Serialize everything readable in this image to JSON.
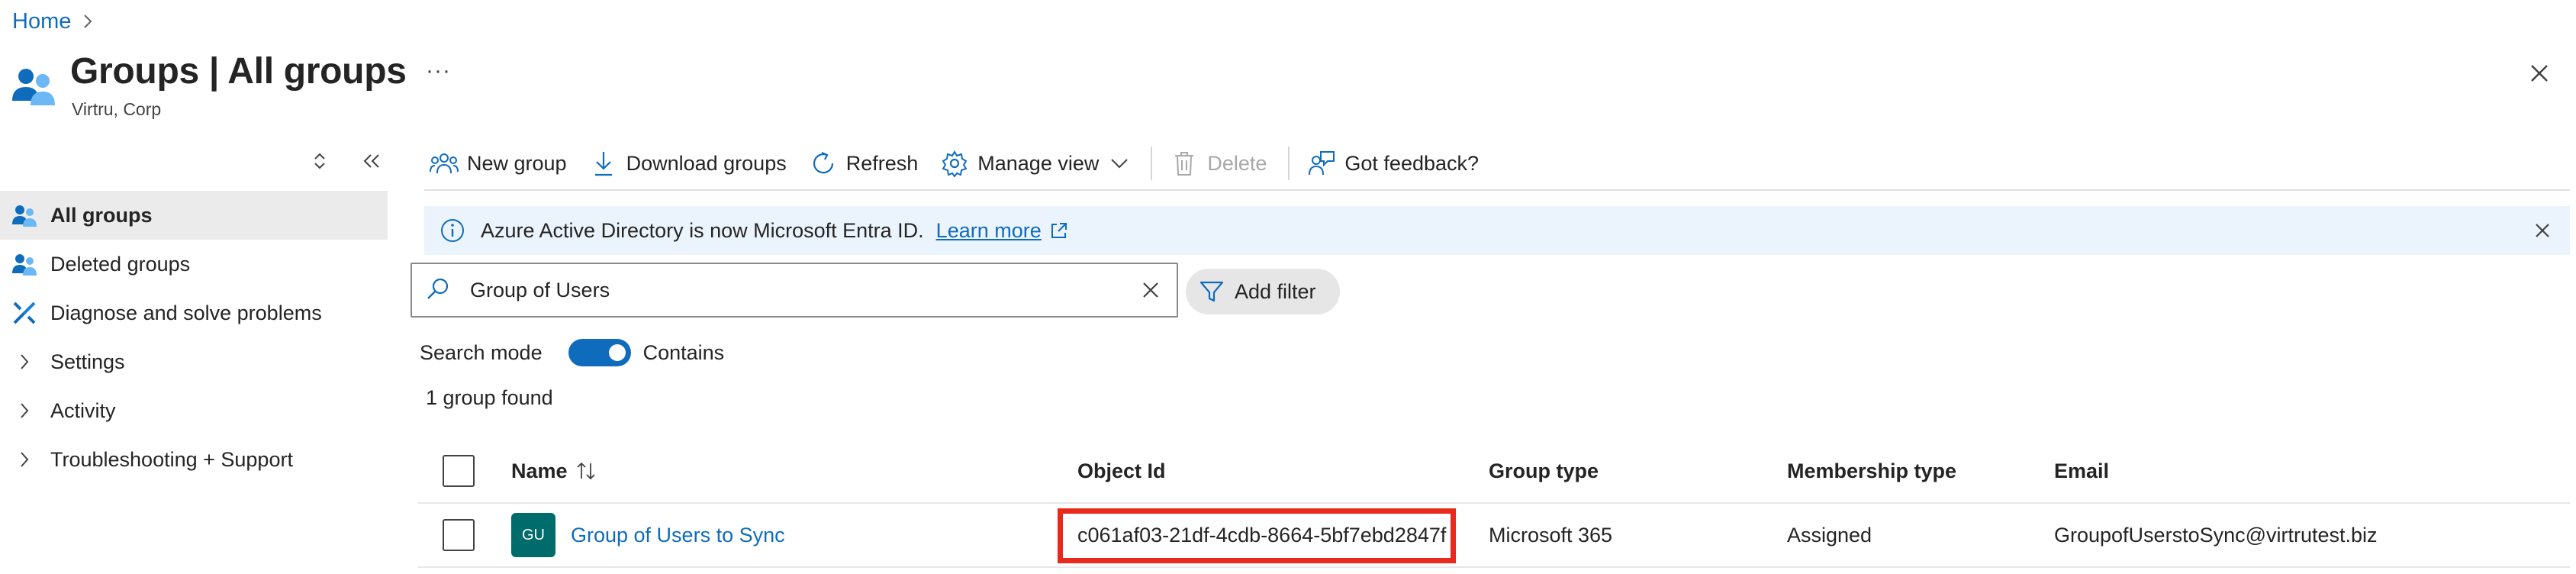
{
  "breadcrumb": {
    "home": "Home",
    "separator": ">"
  },
  "header": {
    "title": "Groups | All groups",
    "subtitle": "Virtru, Corp",
    "more": "···"
  },
  "sidebar": {
    "items": [
      {
        "label": "All groups",
        "icon": "groups-icon",
        "selected": true
      },
      {
        "label": "Deleted groups",
        "icon": "groups-icon"
      },
      {
        "label": "Diagnose and solve problems",
        "icon": "wrench-icon"
      },
      {
        "label": "Settings",
        "icon": "chevron-right-icon"
      },
      {
        "label": "Activity",
        "icon": "chevron-right-icon"
      },
      {
        "label": "Troubleshooting + Support",
        "icon": "chevron-right-icon"
      }
    ]
  },
  "toolbar": {
    "new_group": "New group",
    "download_groups": "Download groups",
    "refresh": "Refresh",
    "manage_view": "Manage view",
    "delete": "Delete",
    "feedback": "Got feedback?"
  },
  "banner": {
    "text": "Azure Active Directory is now Microsoft Entra ID.",
    "link": "Learn more"
  },
  "search": {
    "value": "Group of Users",
    "add_filter": "Add filter"
  },
  "search_mode": {
    "label": "Search mode",
    "value": "Contains",
    "enabled": true
  },
  "result_count": "1 group found",
  "table": {
    "columns": [
      "Name",
      "Object Id",
      "Group type",
      "Membership type",
      "Email"
    ],
    "rows": [
      {
        "avatar": "GU",
        "name": "Group of Users to Sync",
        "object_id": "c061af03-21df-4cdb-8664-5bf7ebd2847f",
        "group_type": "Microsoft 365",
        "membership_type": "Assigned",
        "email": "GroupofUserstoSync@virtrutest.biz"
      }
    ]
  },
  "colors": {
    "accent": "#0f6cbd",
    "highlight": "#e8291c",
    "avatar": "#006b6b",
    "banner": "#ebf3fc"
  }
}
